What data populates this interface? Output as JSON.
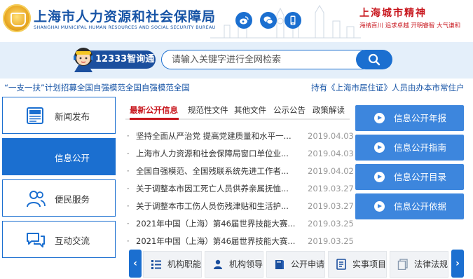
{
  "header": {
    "title": "上海市人力资源和社会保障局",
    "subtitle": "SHANGHAI MUNICIPAL HUMAN RESOURCES AND SOCIAL SECURITY BUREAU",
    "spirit_title": "上海城市精神",
    "spirit_mottos": "海纳百川  追求卓越  开明睿智  大气谦和",
    "icons": [
      "weibo-icon",
      "wechat-icon",
      "mobile-icon"
    ],
    "colors": {
      "brand_blue": "#1754a6",
      "red": "#c8161d"
    }
  },
  "search": {
    "assistant_label": "12333智询通",
    "placeholder": "请输入关键字进行全网检索"
  },
  "ticker": {
    "item1": "“一支一扶”计划招募全国自强模范全国自强模范全国",
    "item2": "持有《上海市居住证》人员由办本市常住户"
  },
  "nav": [
    {
      "label": "新闻发布",
      "icon": "newspaper-icon"
    },
    {
      "label": "信息公开",
      "icon": ""
    },
    {
      "label": "便民服务",
      "icon": "people-icon"
    },
    {
      "label": "互动交流",
      "icon": "chat-icon"
    }
  ],
  "tabs": [
    "最新公开信息",
    "规范性文件",
    "其他文件",
    "公示公告",
    "政策解读"
  ],
  "news": [
    {
      "title": "坚持全面从严治党 提高党建质量和水平一...",
      "date": "2019.04.03"
    },
    {
      "title": "上海市人力资源和社会保障局窗口单位业...",
      "date": "2019.04.03"
    },
    {
      "title": "全国自强模范、全国残联系统先进工作者...",
      "date": "2019.04.02"
    },
    {
      "title": "关于调整本市因工死亡人员供养亲属抚恤...",
      "date": "2019.03.27"
    },
    {
      "title": "关于调整本市工伤人员伤残津贴和生活护...",
      "date": "2019.03.27"
    },
    {
      "title": "2021年中国（上海）第46届世界技能大赛...",
      "date": "2019.03.25"
    },
    {
      "title": "2021年中国（上海）第46届世界技能大赛...",
      "date": "2019.03.25"
    }
  ],
  "info_buttons": [
    "信息公开年报",
    "信息公开指南",
    "信息公开目录",
    "信息公开依据"
  ],
  "quick_links": [
    {
      "label": "机构职能",
      "icon": "list-icon"
    },
    {
      "label": "机构领导",
      "icon": "person-icon"
    },
    {
      "label": "公开申请",
      "icon": "book-icon"
    },
    {
      "label": "实事项目",
      "icon": "document-icon"
    },
    {
      "label": "法律法规",
      "icon": "copy-icon"
    }
  ],
  "carousel": {
    "prev": "‹",
    "next": "›"
  }
}
